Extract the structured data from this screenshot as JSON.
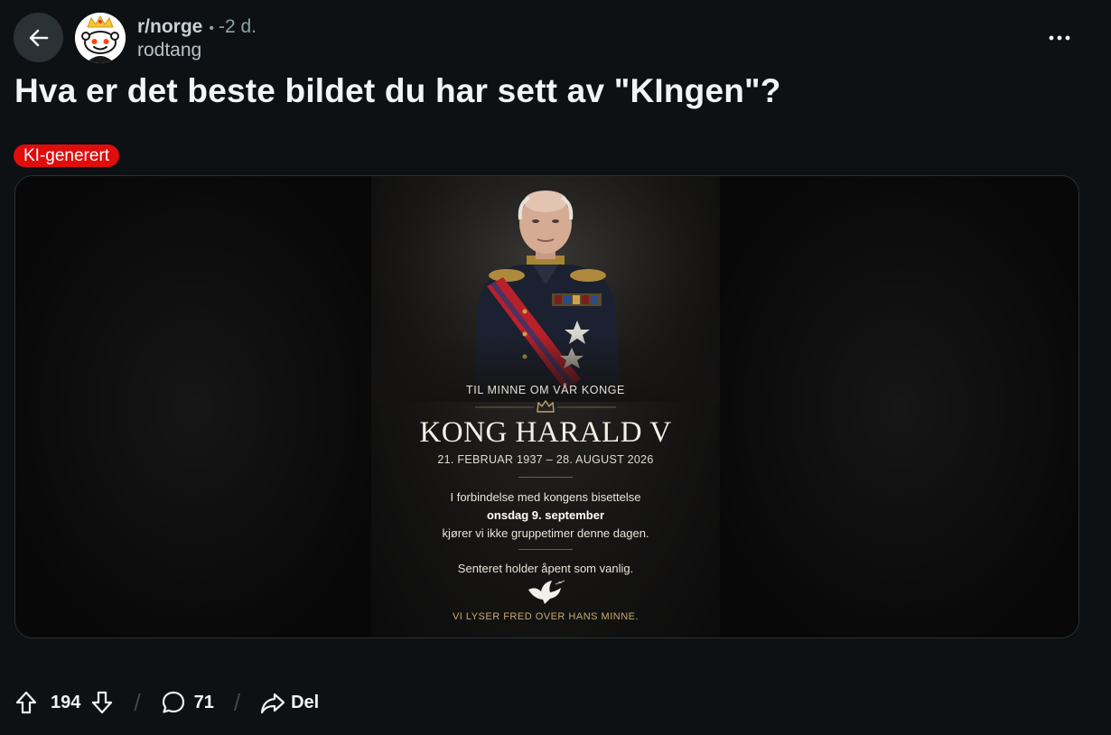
{
  "header": {
    "subreddit": "r/norge",
    "separator": "•",
    "time": "-2 d.",
    "author": "rodtang"
  },
  "post": {
    "title": "Hva er det beste bildet du har sett av \"KIngen\"?",
    "flair": "KI-generert",
    "flair_color": "#e00d0d"
  },
  "poster": {
    "pre_title": "TIL MINNE OM VÅR KONGE",
    "title": "KONG HARALD V",
    "dates": "21. FEBRUAR 1937 – 28. AUGUST 2026",
    "info_line1": "I forbindelse med kongens bisettelse",
    "info_line2": "onsdag 9. september",
    "info_line3": "kjører vi ikke gruppetimer denne dagen.",
    "open_line": "Senteret holder åpent som vanlig.",
    "memory_line": "VI LYSER FRED OVER HANS MINNE."
  },
  "actions": {
    "upvotes": "194",
    "comments": "71",
    "share_label": "Del"
  },
  "icons": [
    "back-arrow-icon",
    "subreddit-avatar-icon",
    "more-icon",
    "crown-icon",
    "dove-icon",
    "upvote-icon",
    "downvote-icon",
    "comment-icon",
    "share-icon"
  ],
  "colors": {
    "background": "#0e1113",
    "flair": "#e00d0d",
    "accent_gold": "#c7ab72"
  }
}
